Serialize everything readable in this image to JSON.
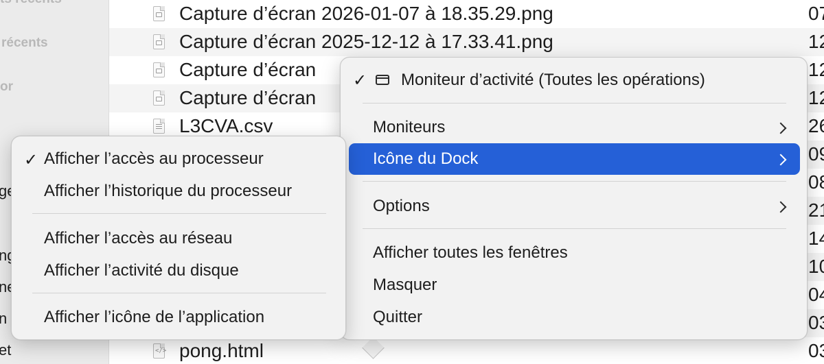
{
  "sidebar": {
    "items": [
      {
        "label": "ts récents"
      },
      {
        "label": "récents"
      },
      {
        "label": "or"
      }
    ],
    "fragments": [
      "ge",
      "ng",
      "ne",
      "n",
      "et"
    ]
  },
  "files": [
    {
      "name": "Capture d’écran 2026-01-07 à 18.35.29.png",
      "date": "07",
      "icon": "image-file-icon"
    },
    {
      "name": "Capture d’écran 2025-12-12 à 17.33.41.png",
      "date": "12",
      "icon": "image-file-icon"
    },
    {
      "name": "Capture d’écran",
      "date": "12",
      "icon": "image-file-icon"
    },
    {
      "name": "Capture d’écran",
      "date": "12",
      "icon": "image-file-icon"
    },
    {
      "name": "L3CVA.csv",
      "date": "26",
      "icon": "csv-file-icon"
    },
    {
      "name": "",
      "date": "09",
      "icon": ""
    },
    {
      "name": "",
      "date": "08",
      "icon": ""
    },
    {
      "name": "",
      "date": "21",
      "icon": ""
    },
    {
      "name": "",
      "date": "14",
      "icon": ""
    },
    {
      "name": "",
      "date": "10",
      "icon": ""
    },
    {
      "name": "",
      "date": "04",
      "icon": ""
    },
    {
      "name": "",
      "date": "03",
      "icon": ""
    },
    {
      "name": "pong.html",
      "date": "03",
      "icon": "html-file-icon"
    }
  ],
  "dock_menu": {
    "app_window": {
      "label": "Moniteur d’activité (Toutes les opérations)",
      "checked": "✓"
    },
    "items": [
      {
        "label": "Moniteurs"
      },
      {
        "label": "Icône du Dock"
      },
      {
        "label": "Options"
      },
      {
        "label": "Afficher toutes les fenêtres"
      },
      {
        "label": "Masquer"
      },
      {
        "label": "Quitter"
      }
    ]
  },
  "dock_icon_submenu": {
    "checkmark": "✓",
    "items": [
      {
        "label": "Afficher l’accès au processeur"
      },
      {
        "label": "Afficher l’historique du processeur"
      },
      {
        "label": "Afficher l’accès au réseau"
      },
      {
        "label": "Afficher l’activité du disque"
      },
      {
        "label": "Afficher l’icône de l’application"
      }
    ]
  },
  "colors": {
    "selection": "#2560d7",
    "menu_bg": "#f2f2f2",
    "sidebar_bg": "#ebebeb"
  }
}
